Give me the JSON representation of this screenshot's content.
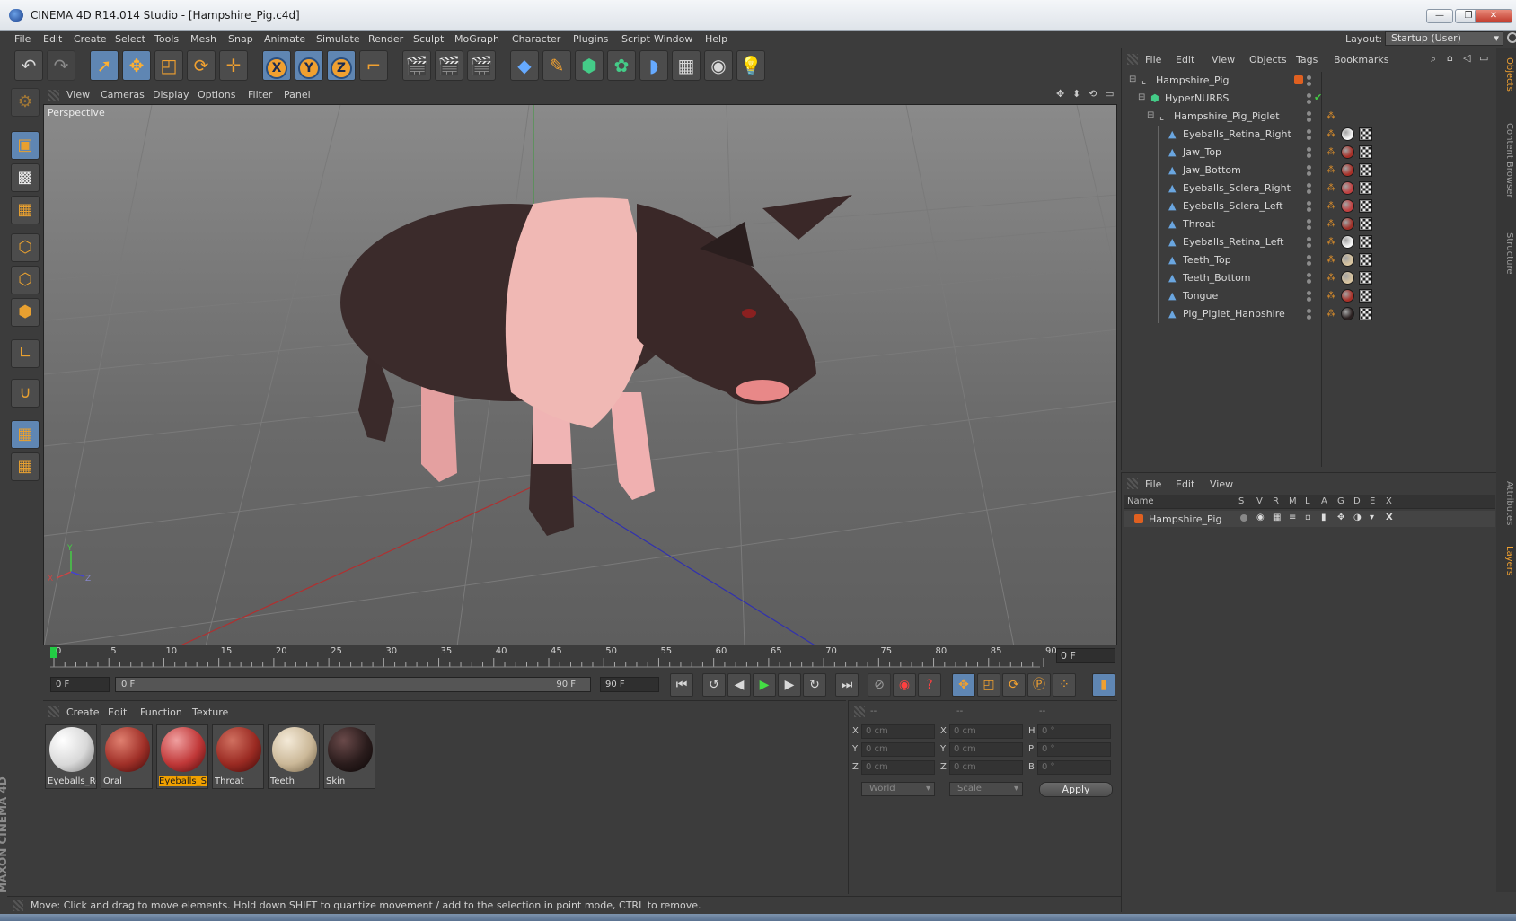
{
  "window": {
    "title": "CINEMA 4D R14.014 Studio - [Hampshire_Pig.c4d]"
  },
  "menu": [
    "File",
    "Edit",
    "Create",
    "Select",
    "Tools",
    "Mesh",
    "Snap",
    "Animate",
    "Simulate",
    "Render",
    "Sculpt",
    "MoGraph",
    "Character",
    "Plugins",
    "Script",
    "Window",
    "Help"
  ],
  "layout": {
    "label": "Layout:",
    "value": "Startup (User)"
  },
  "viewport": {
    "menu": [
      "View",
      "Cameras",
      "Display",
      "Options",
      "Filter",
      "Panel"
    ],
    "label": "Perspective"
  },
  "timeline": {
    "ticks": [
      "0",
      "5",
      "10",
      "15",
      "20",
      "25",
      "30",
      "35",
      "40",
      "45",
      "50",
      "55",
      "60",
      "65",
      "70",
      "75",
      "80",
      "85",
      "90"
    ],
    "current_frame": "0 F"
  },
  "playback": {
    "start": "0 F",
    "range_start": "0 F",
    "range_end": "90 F",
    "end": "90 F"
  },
  "materials": {
    "menu": [
      "Create",
      "Edit",
      "Function",
      "Texture"
    ],
    "items": [
      {
        "name": "Eyeballs_Re"
      },
      {
        "name": "Oral"
      },
      {
        "name": "Eyeballs_Sc"
      },
      {
        "name": "Throat"
      },
      {
        "name": "Teeth"
      },
      {
        "name": "Skin"
      }
    ]
  },
  "coords": {
    "headers": [
      "--",
      "--",
      "--"
    ],
    "rows": [
      {
        "l1": "X",
        "v1": "0 cm",
        "l2": "X",
        "v2": "0 cm",
        "l3": "H",
        "v3": "0 °"
      },
      {
        "l1": "Y",
        "v1": "0 cm",
        "l2": "Y",
        "v2": "0 cm",
        "l3": "P",
        "v3": "0 °"
      },
      {
        "l1": "Z",
        "v1": "0 cm",
        "l2": "Z",
        "v2": "0 cm",
        "l3": "B",
        "v3": "0 °"
      }
    ],
    "space": "World",
    "mode": "Scale",
    "apply": "Apply"
  },
  "objects": {
    "menu": [
      "File",
      "Edit",
      "View",
      "Objects",
      "Tags",
      "Bookmarks"
    ],
    "tree": [
      {
        "name": "Hampshire_Pig",
        "level": 0,
        "type": "null"
      },
      {
        "name": "HyperNURBS",
        "level": 1,
        "type": "nurbs"
      },
      {
        "name": "Hampshire_Pig_Piglet",
        "level": 2,
        "type": "null"
      },
      {
        "name": "Eyeballs_Retina_Right",
        "level": 3,
        "type": "mesh",
        "mat": "#f4f4f4"
      },
      {
        "name": "Jaw_Top",
        "level": 3,
        "type": "mesh",
        "mat": "#a83028"
      },
      {
        "name": "Jaw_Bottom",
        "level": 3,
        "type": "mesh",
        "mat": "#a83028"
      },
      {
        "name": "Eyeballs_Sclera_Right",
        "level": 3,
        "type": "mesh",
        "mat": "#c04040"
      },
      {
        "name": "Eyeballs_Sclera_Left",
        "level": 3,
        "type": "mesh",
        "mat": "#c04040"
      },
      {
        "name": "Throat",
        "level": 3,
        "type": "mesh",
        "mat": "#a03028"
      },
      {
        "name": "Eyeballs_Retina_Left",
        "level": 3,
        "type": "mesh",
        "mat": "#f4f4f4"
      },
      {
        "name": "Teeth_Top",
        "level": 3,
        "type": "mesh",
        "mat": "#d8c4a0"
      },
      {
        "name": "Teeth_Bottom",
        "level": 3,
        "type": "mesh",
        "mat": "#d8c4a0"
      },
      {
        "name": "Tongue",
        "level": 3,
        "type": "mesh",
        "mat": "#a83028"
      },
      {
        "name": "Pig_Piglet_Hanpshire",
        "level": 3,
        "type": "mesh",
        "mat": "#2a2020"
      }
    ]
  },
  "layers": {
    "menu": [
      "File",
      "Edit",
      "View"
    ],
    "columns": [
      "Name",
      "S",
      "V",
      "R",
      "M",
      "L",
      "A",
      "G",
      "D",
      "E",
      "X"
    ],
    "rows": [
      {
        "name": "Hampshire_Pig",
        "color": "#e06020"
      }
    ]
  },
  "side_tabs": [
    "Objects",
    "Content Browser",
    "Structure",
    "Attributes",
    "Layers"
  ],
  "status": "Move: Click and drag to move elements. Hold down SHIFT to quantize movement / add to the selection in point mode, CTRL to remove.",
  "branding": "MAXON CINEMA 4D",
  "colors": {
    "accent": "#f0a030",
    "selection": "#5f86b3",
    "panel": "#3c3c3c"
  }
}
